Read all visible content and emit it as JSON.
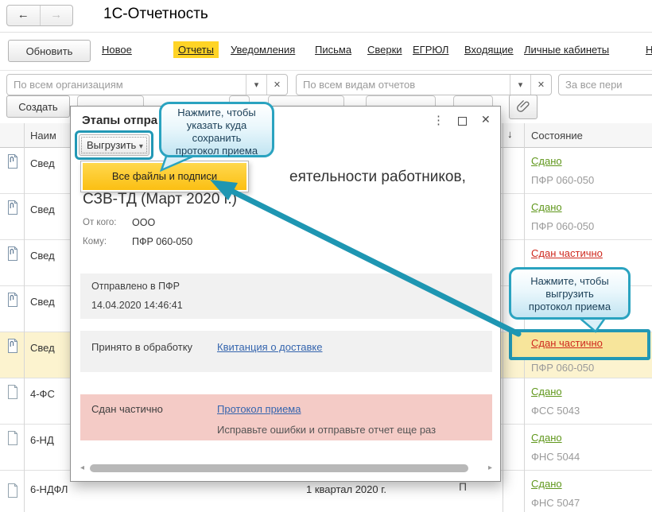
{
  "app": {
    "title": "1С-Отчетность"
  },
  "icons": {
    "back": "←",
    "forward": "→",
    "caret_down": "▾",
    "clear": "✕",
    "dots_menu": "⋮",
    "close": "✕",
    "sort_desc": "↓",
    "scroll_left": "◂",
    "scroll_right": "▸"
  },
  "tabs": {
    "update_button": "Обновить",
    "items": [
      {
        "label": "Новое"
      },
      {
        "label": "Отчеты",
        "active": true
      },
      {
        "label": "Уведомления"
      },
      {
        "label": "Письма"
      },
      {
        "label": "Сверки"
      },
      {
        "label": "ЕГРЮЛ"
      },
      {
        "label": "Входящие"
      },
      {
        "label": "Личные кабинеты"
      },
      {
        "label": "Н",
        "partial": true
      }
    ]
  },
  "filters": {
    "organizations_placeholder": "По всем организациям",
    "report_types_placeholder": "По всем видам отчетов",
    "period_placeholder": "За все пери"
  },
  "toolbar": {
    "create_button": "Создать"
  },
  "table": {
    "header": {
      "name": "Наим",
      "state": "Состояние"
    },
    "rows": [
      {
        "name": "Свед",
        "state": "Сдано",
        "dept": "ПФР 060-050"
      },
      {
        "name": "Свед",
        "state": "Сдано",
        "dept": "ПФР 060-050"
      },
      {
        "name": "Свед",
        "state": "Сдан частично"
      },
      {
        "name": "Свед"
      },
      {
        "name": "Свед",
        "state": "Сдан частично",
        "dept": "ПФР 060-050",
        "highlighted": true
      },
      {
        "name": "4-ФС",
        "state": "Сдано",
        "dept": "ФСС 5043"
      },
      {
        "name": "6-НД",
        "state": "Сдано",
        "dept": "ФНС 5044"
      },
      {
        "name": "6-НДФЛ",
        "period": "1 квартал 2020 г.",
        "fragment": "П",
        "state": "Сдано",
        "dept": "ФНС 5047"
      }
    ]
  },
  "dialog": {
    "title": "Этапы отпра",
    "export_button": "Выгрузить",
    "menu_item": "Все файлы и подписи",
    "report_title_line1": "еятельности работников,",
    "report_title_line2": "СЗВ-ТД (Март 2020 г.)",
    "from_label": "От кого:",
    "from_value": "ООО",
    "to_label": "Кому:",
    "to_value": "ПФР 060-050",
    "sent_label": "Отправлено в ПФР",
    "sent_datetime": "14.04.2020 14:46:41",
    "accepted_label": "Принято в обработку",
    "accepted_link": "Квитанция о доставке",
    "partial_label": "Сдан частично",
    "partial_link": "Протокол приема",
    "partial_note": "Исправьте ошибки и отправьте отчет еще раз"
  },
  "callouts": {
    "save_lines": [
      "Нажмите, чтобы",
      "указать куда",
      "сохранить",
      "протокол приема"
    ],
    "download_lines": [
      "Нажмите, чтобы",
      "выгрузить",
      "протокол приема"
    ]
  },
  "colors": {
    "accent_teal": "#2298b5",
    "tab_highlight_yellow": "#ffd426",
    "menu_item_yellow": "#fcc827",
    "status_green": "#60971c",
    "status_red": "#cf2a1f",
    "link_blue": "#3565ae",
    "row_highlight": "#fcf3cf",
    "cell_highlight": "#f7e59b",
    "error_pink": "#f4cbc6",
    "section_gray": "#f1f1f1"
  }
}
